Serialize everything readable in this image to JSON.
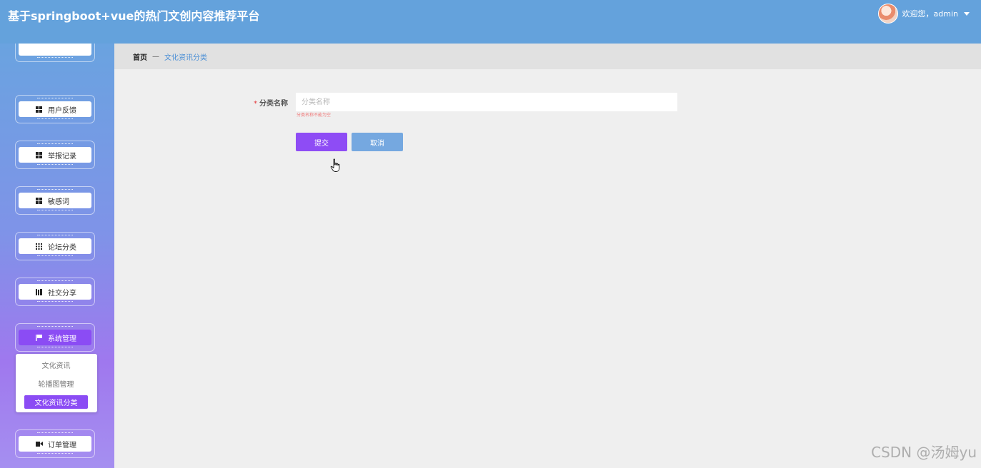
{
  "header": {
    "title": "基于springboot+vue的热门文创内容推荐平台",
    "welcome_text": "欢迎您，admin",
    "bg_color": "#64a2dc"
  },
  "sidebar": {
    "items": [
      {
        "label": "用户反馈",
        "icon": "grid-icon",
        "active": false
      },
      {
        "label": "举报记录",
        "icon": "grid-icon",
        "active": false
      },
      {
        "label": "敏感词",
        "icon": "grid-icon",
        "active": false
      },
      {
        "label": "论坛分类",
        "icon": "grid9-icon",
        "active": false
      },
      {
        "label": "社交分享",
        "icon": "book-icon",
        "active": false
      },
      {
        "label": "系统管理",
        "icon": "flag-icon",
        "active": true
      },
      {
        "label": "订单管理",
        "icon": "video-icon",
        "active": false
      }
    ],
    "submenu": [
      {
        "label": "文化资讯",
        "active": false
      },
      {
        "label": "轮播图管理",
        "active": false
      },
      {
        "label": "文化资讯分类",
        "active": true
      }
    ],
    "active_color": "#8b4cf4"
  },
  "breadcrumb": {
    "home": "首页",
    "separator": "—",
    "current": "文化资讯分类"
  },
  "form": {
    "field_label": "分类名称",
    "required_mark": "*",
    "field_value": "",
    "field_placeholder": "分类名称",
    "error_text": "分类名称不能为空",
    "submit_label": "提交",
    "cancel_label": "取消",
    "submit_color": "#8e4cf5",
    "cancel_color": "#75a8e0"
  },
  "watermark": "CSDN @汤姆yu"
}
